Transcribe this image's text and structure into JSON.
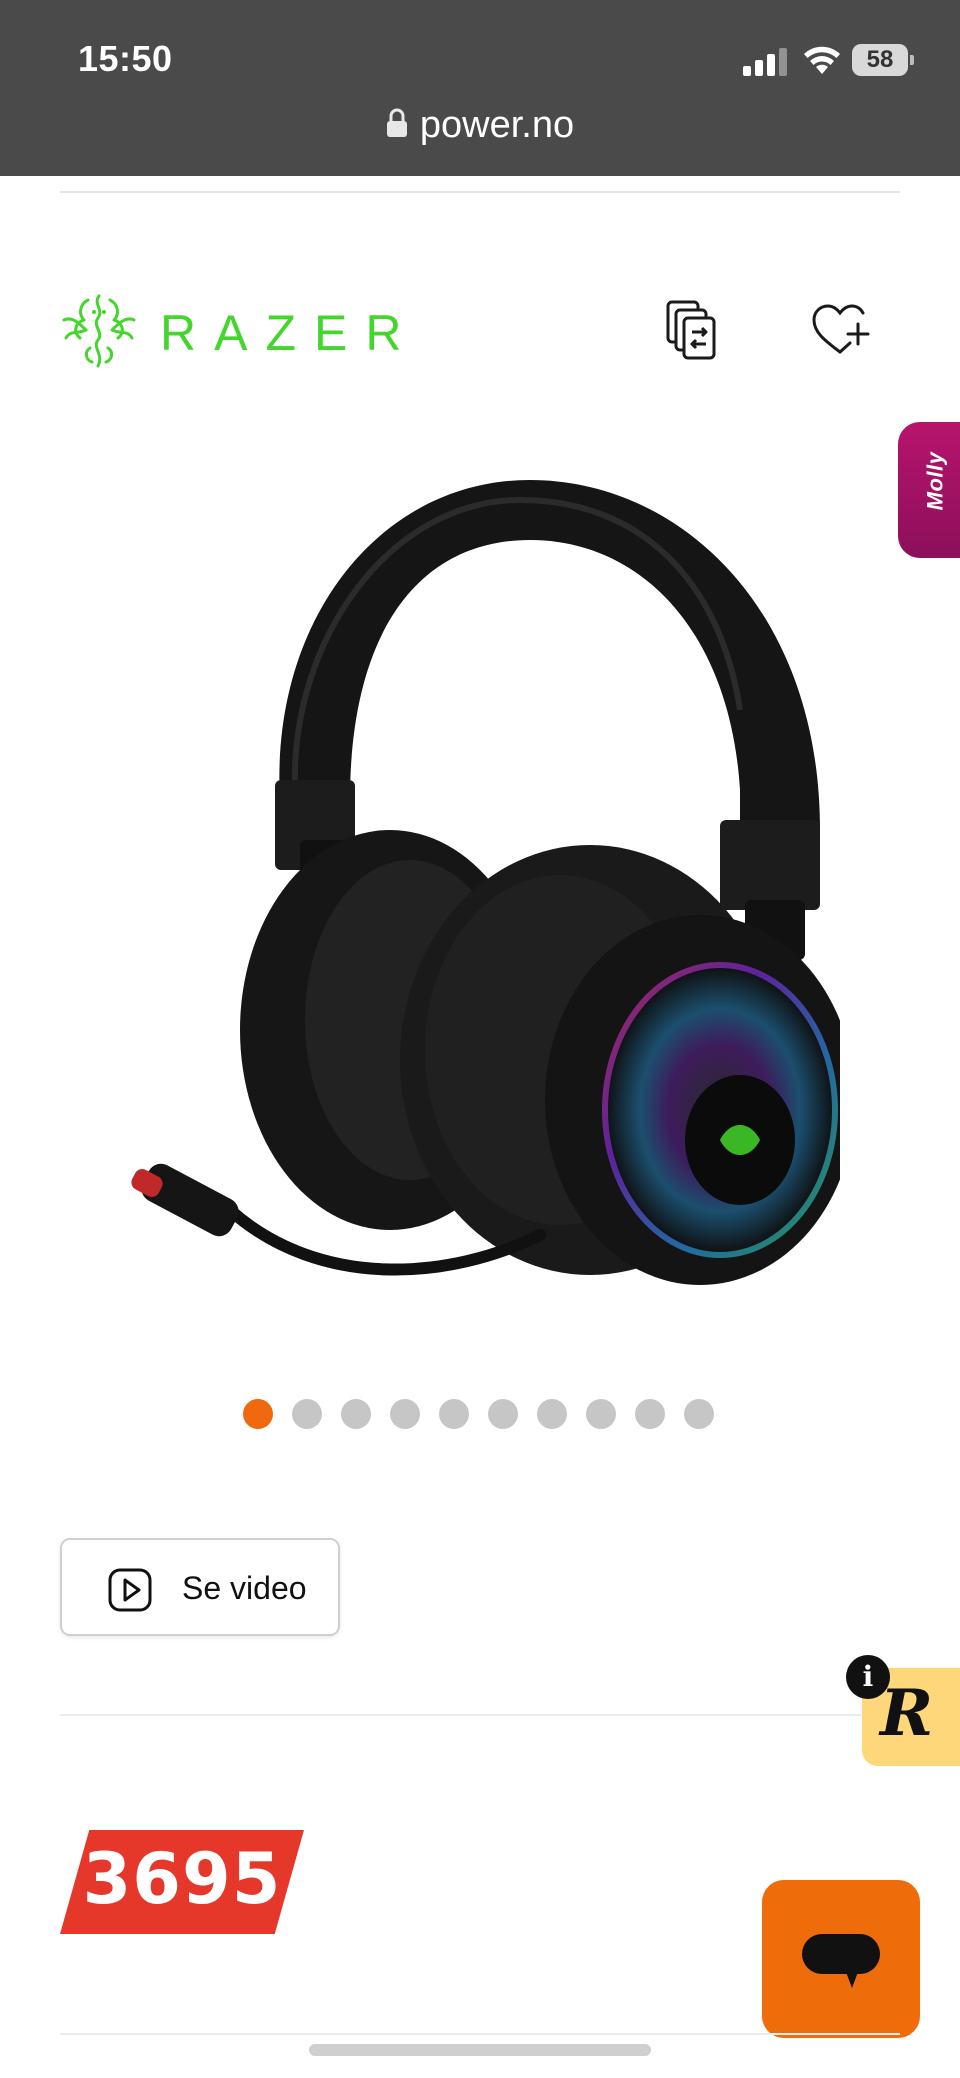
{
  "status_bar": {
    "time": "15:50",
    "battery": "58",
    "icons": [
      "signal-icon",
      "wifi-icon",
      "battery-icon"
    ]
  },
  "browser": {
    "url": "power.no",
    "lock_icon": "lock-icon"
  },
  "brand": {
    "name": "RAZER",
    "color": "#44d62c",
    "logo_icon": "razer-snake-logo"
  },
  "actions": {
    "compare_icon": "compare-icon",
    "wishlist_icon": "heart-plus-icon"
  },
  "side_tab": {
    "label": "Molly"
  },
  "product": {
    "image": "gaming-headset-with-microphone",
    "image_count": 10,
    "active_image": 1
  },
  "video": {
    "label": "Se video",
    "icon": "play-icon"
  },
  "reviews_widget": {
    "info": "i",
    "badge": "R"
  },
  "price": {
    "value": "3695",
    "color": "#e6372b"
  },
  "chat": {
    "icon": "chat-bubble-icon",
    "color": "#ee6c0a"
  }
}
